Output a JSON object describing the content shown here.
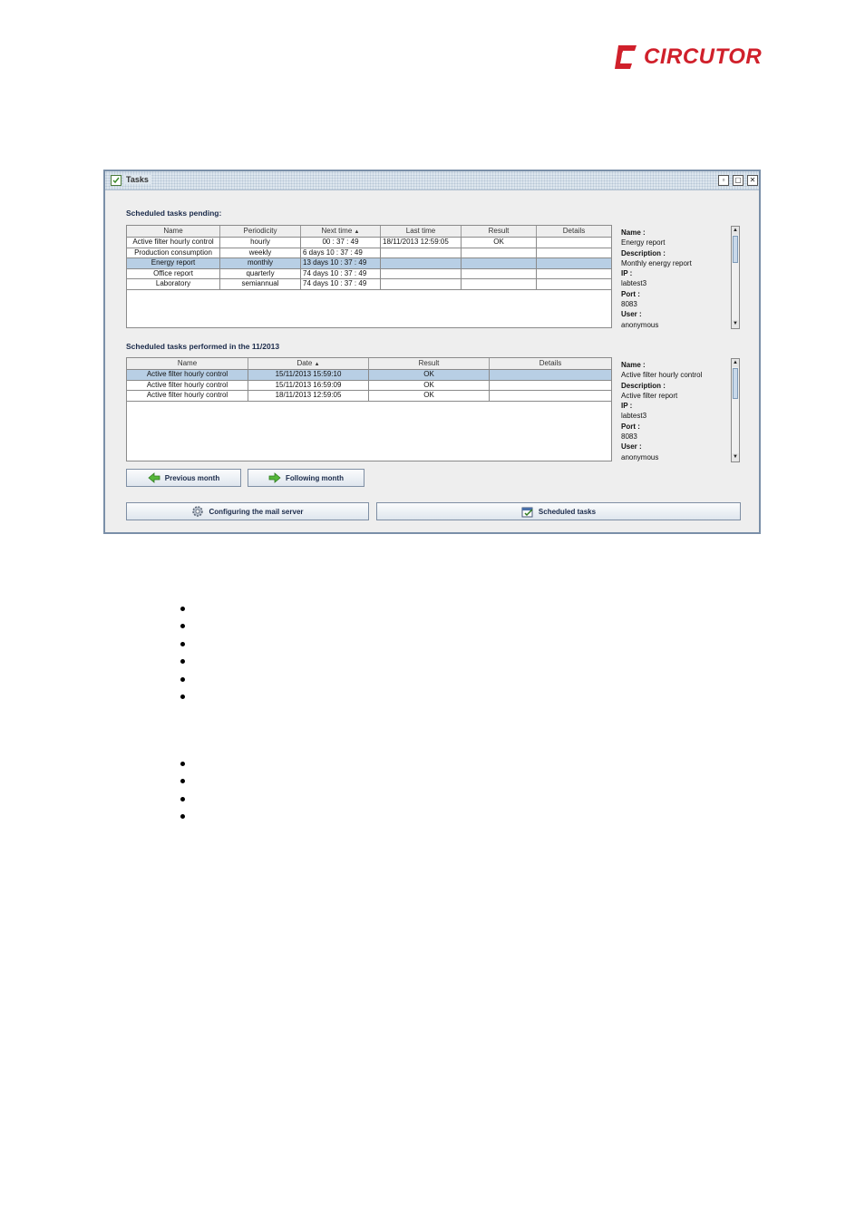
{
  "brand": {
    "name": "CIRCUTOR",
    "color": "#d0202b"
  },
  "window": {
    "title": "Tasks",
    "pending_label": "Scheduled tasks pending:",
    "performed_label": "Scheduled tasks performed in the 11/2013",
    "pending_table": {
      "columns": [
        "Name",
        "Periodicity",
        "Next time",
        "Last time",
        "Result",
        "Details"
      ],
      "sort_indicator": "▲",
      "rows": [
        [
          "Active filter hourly control",
          "hourly",
          "00 : 37 : 49",
          "18/11/2013  12:59:05",
          "OK",
          ""
        ],
        [
          "Production consumption",
          "weekly",
          "6 days   10 : 37 : 49",
          "",
          "",
          ""
        ],
        [
          "Energy report",
          "monthly",
          "13 days   10 : 37 : 49",
          "",
          "",
          ""
        ],
        [
          "Office report",
          "quarterly",
          "74 days   10 : 37 : 49",
          "",
          "",
          ""
        ],
        [
          "Laboratory",
          "semiannual",
          "74 days   10 : 37 : 49",
          "",
          "",
          ""
        ]
      ],
      "selected_row": 2
    },
    "pending_details": {
      "name_label": "Name :",
      "name": "Energy report",
      "description_label": "Description :",
      "description": "Monthly energy report",
      "ip_label": "IP :",
      "ip": "labtest3",
      "port_label": "Port :",
      "port": "8083",
      "user_label": "User :",
      "user": "anonymous"
    },
    "performed_table": {
      "columns": [
        "Name",
        "Date",
        "Result",
        "Details"
      ],
      "sort_indicator": "▲",
      "rows": [
        [
          "Active filter hourly control",
          "15/11/2013  15:59:10",
          "OK",
          ""
        ],
        [
          "Active filter hourly control",
          "15/11/2013  16:59:09",
          "OK",
          ""
        ],
        [
          "Active filter hourly control",
          "18/11/2013  12:59:05",
          "OK",
          ""
        ]
      ],
      "selected_row": 0
    },
    "performed_details": {
      "name_label": "Name :",
      "name": "Active filter hourly control",
      "description_label": "Description :",
      "description": "Active filter report",
      "ip_label": "IP :",
      "ip": "labtest3",
      "port_label": "Port :",
      "port": "8083",
      "user_label": "User :",
      "user": "anonymous"
    },
    "buttons": {
      "previous_month": "Previous month",
      "following_month": "Following month",
      "mail_server": "Configuring the mail server",
      "scheduled_tasks": "Scheduled tasks"
    }
  }
}
